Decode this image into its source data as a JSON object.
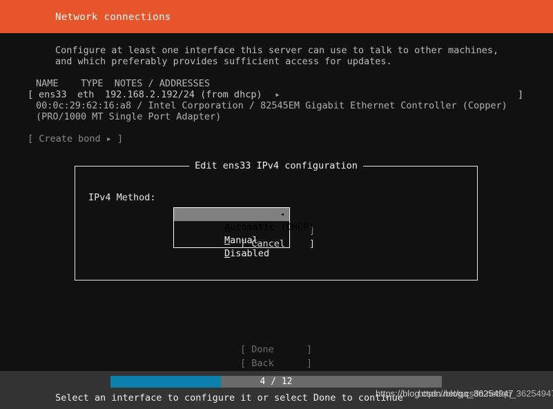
{
  "header": {
    "title": "Network connections"
  },
  "intro": {
    "line1": "Configure at least one interface this server can use to talk to other machines,",
    "line2": "and which preferably provides sufficient access for updates."
  },
  "interface_table": {
    "columns_line": "NAME    TYPE  NOTES / ADDRESSES",
    "rows": [
      {
        "open_bracket": "[",
        "name": "ens33",
        "type": "eth",
        "address": "192.168.2.192/24 (from dhcp)",
        "arrow_icon": "▸",
        "close_bracket": "]",
        "hardware_line1": "00:0c:29:62:16:a8 / Intel Corporation / 82545EM Gigabit Ethernet Controller (Copper)",
        "hardware_line2": "(PRO/1000 MT Single Port Adapter)"
      }
    ]
  },
  "create_bond": {
    "label": "[ Create bond ▸ ]"
  },
  "dialog": {
    "title": "Edit ens33 IPv4 configuration",
    "method_label": "IPv4 Method:",
    "dropdown": {
      "marker_icon": "◂",
      "options": [
        {
          "accel": "A",
          "rest": "utomatic (DHCP)",
          "selected": true
        },
        {
          "accel": "M",
          "rest": "anual",
          "selected": false
        },
        {
          "accel": "D",
          "rest": "isabled",
          "selected": false
        }
      ]
    },
    "save_bracket": "]",
    "cancel_label": "[ Cancel",
    "cancel_bracket": "]"
  },
  "nav": {
    "done_label": "[ Done",
    "done_bracket": "]",
    "back_label": "[ Back",
    "back_bracket": "]"
  },
  "footer": {
    "progress_text": "4 / 12",
    "progress_current": 4,
    "progress_total": 12,
    "status_text": "Select an interface to configure it or select Done to continue",
    "watermark_line1": "https://blog.csdn.net/qq_36254947",
    "watermark_line2": "https://blog.csdn.net/qq_36254947"
  },
  "colors": {
    "header_orange": "#e8552a",
    "terminal_bg": "#111111",
    "footer_bg": "#333333",
    "progress_blue": "#0c80ad",
    "progress_track": "#6a6a6a",
    "selection_gray": "#808080"
  }
}
